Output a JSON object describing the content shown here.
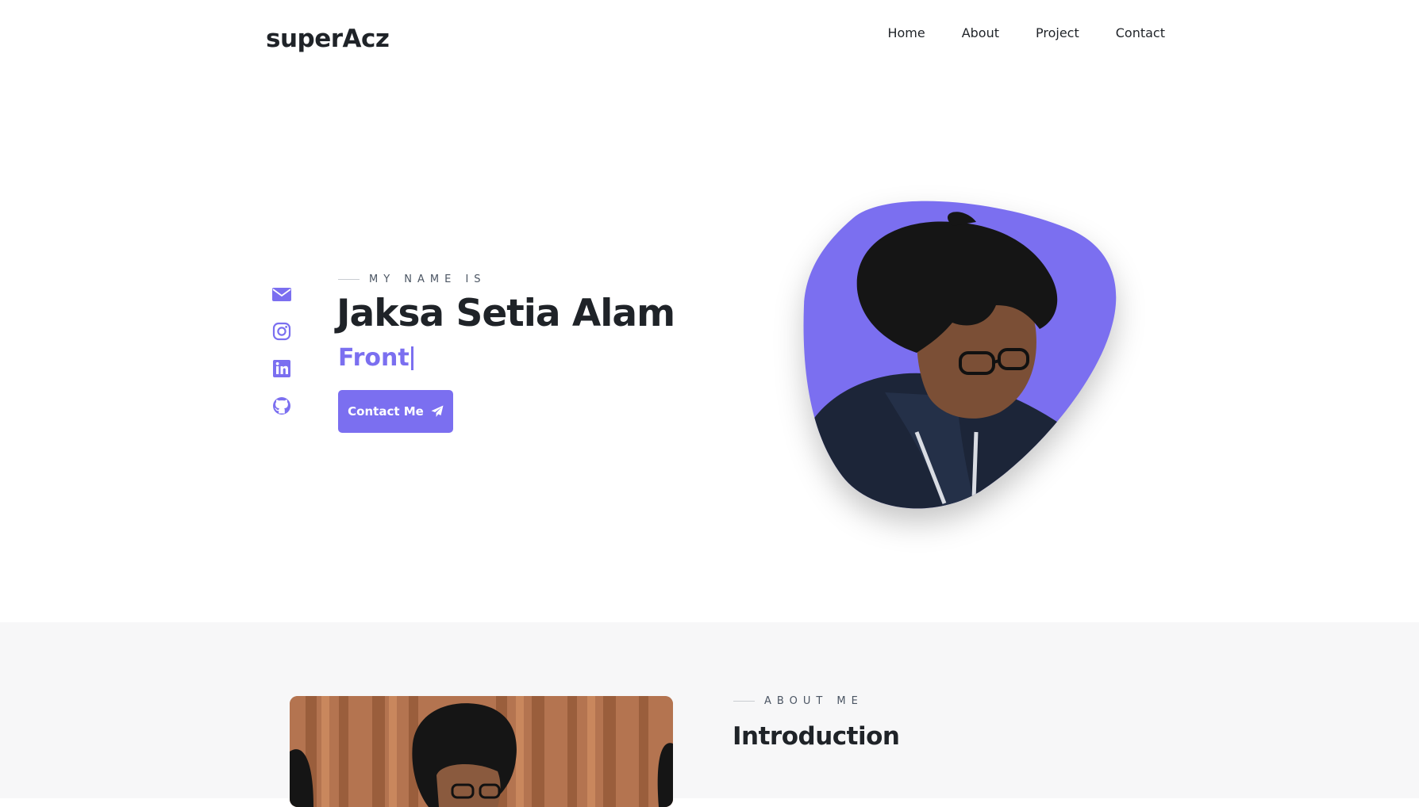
{
  "brand": {
    "logo_text": "superAcz"
  },
  "nav": {
    "links": [
      {
        "label": "Home"
      },
      {
        "label": "About"
      },
      {
        "label": "Project"
      },
      {
        "label": "Contact"
      }
    ]
  },
  "hero": {
    "kicker": "MY NAME IS",
    "name": "Jaksa Setia Alam",
    "role_typed": "Front",
    "cta_label": "Contact Me",
    "cta_icon": "paper-plane-icon",
    "social_icons": [
      "envelope-icon",
      "instagram-icon",
      "linkedin-icon",
      "github-icon"
    ]
  },
  "about": {
    "kicker": "ABOUT ME",
    "title": "Introduction"
  },
  "colors": {
    "accent": "#7b6ff0",
    "text": "#1f2328",
    "section_bg": "#f7f7f8"
  }
}
